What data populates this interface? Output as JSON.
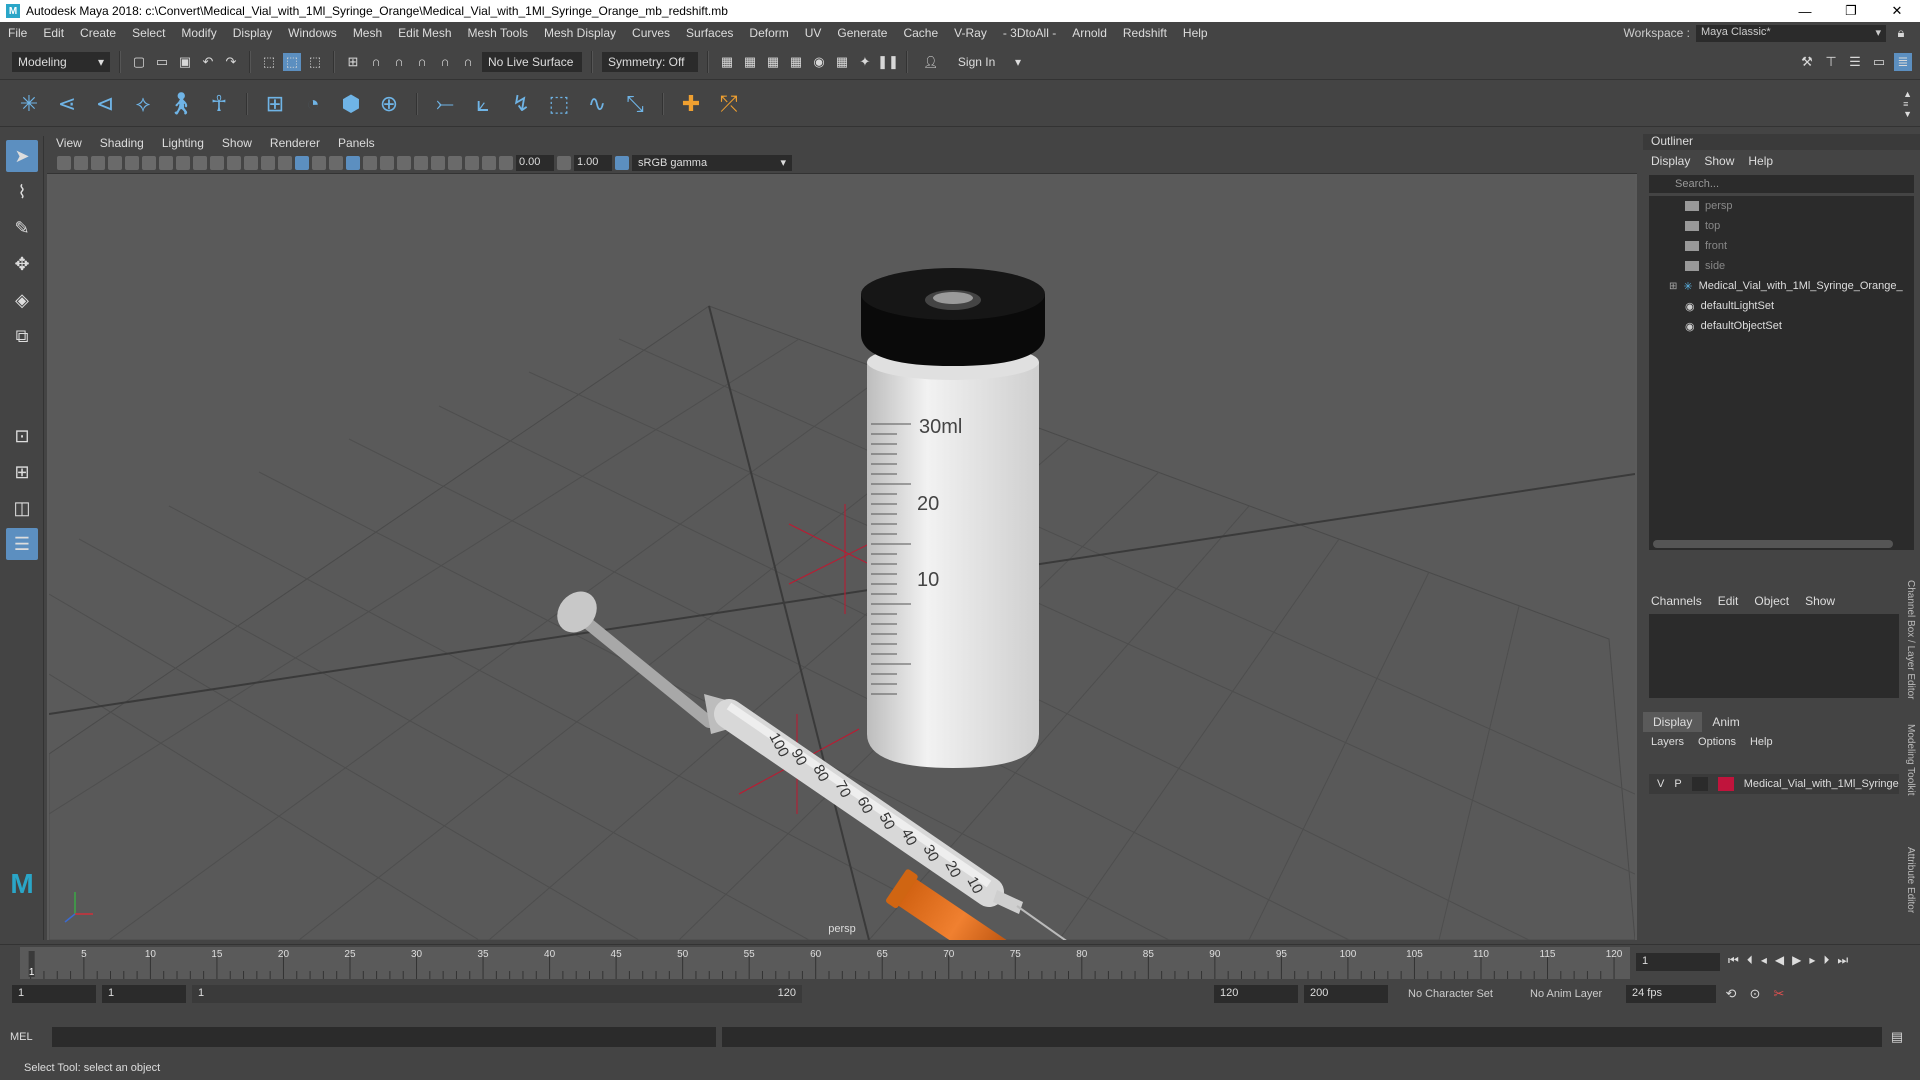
{
  "window": {
    "title": "Autodesk Maya 2018: c:\\Convert\\Medical_Vial_with_1Ml_Syringe_Orange\\Medical_Vial_with_1Ml_Syringe_Orange_mb_redshift.mb",
    "logo_letter": "M",
    "controls": {
      "minimize": "—",
      "maximize": "❐",
      "close": "✕"
    }
  },
  "menubar": {
    "items": [
      "File",
      "Edit",
      "Create",
      "Select",
      "Modify",
      "Display",
      "Windows",
      "Mesh",
      "Edit Mesh",
      "Mesh Tools",
      "Mesh Display",
      "Curves",
      "Surfaces",
      "Deform",
      "UV",
      "Generate",
      "Cache",
      "V-Ray",
      "- 3DtoAll -",
      "Arnold",
      "Redshift",
      "Help"
    ],
    "workspace_label": "Workspace :",
    "workspace_value": "Maya Classic*"
  },
  "statusline": {
    "mode": "Modeling",
    "live_surface": "No Live Surface",
    "symmetry": "Symmetry: Off",
    "sign_in": "Sign In"
  },
  "viewport": {
    "menu": [
      "View",
      "Shading",
      "Lighting",
      "Show",
      "Renderer",
      "Panels"
    ],
    "exposure": "0.00",
    "gamma": "1.00",
    "color_space": "sRGB gamma",
    "camera_label": "persp",
    "vial_labels": [
      "30ml",
      "20",
      "10"
    ],
    "syringe_labels": [
      "100",
      "90",
      "80",
      "70",
      "60",
      "50",
      "40",
      "30",
      "20",
      "10"
    ]
  },
  "outliner": {
    "title": "Outliner",
    "menu": [
      "Display",
      "Show",
      "Help"
    ],
    "search_placeholder": "Search...",
    "items": [
      {
        "label": "persp",
        "dim": true
      },
      {
        "label": "top",
        "dim": true
      },
      {
        "label": "front",
        "dim": true
      },
      {
        "label": "side",
        "dim": true
      },
      {
        "label": "Medical_Vial_with_1Ml_Syringe_Orange_",
        "dim": false
      },
      {
        "label": "defaultLightSet",
        "dim": false
      },
      {
        "label": "defaultObjectSet",
        "dim": false
      }
    ]
  },
  "channelbox": {
    "menu": [
      "Channels",
      "Edit",
      "Object",
      "Show"
    ]
  },
  "layereditor": {
    "tabs": [
      "Display",
      "Anim"
    ],
    "menu": [
      "Layers",
      "Options",
      "Help"
    ],
    "layer": {
      "v": "V",
      "p": "P",
      "name": "Medical_Vial_with_1Ml_Syringe",
      "color": "#c0143c"
    }
  },
  "sidetabs": [
    "Channel Box / Layer Editor",
    "Modeling Toolkit",
    "Attribute Editor"
  ],
  "timeline": {
    "ticks": [
      "5",
      "10",
      "15",
      "20",
      "25",
      "30",
      "35",
      "40",
      "45",
      "50",
      "55",
      "60",
      "65",
      "70",
      "75",
      "80",
      "85",
      "90",
      "95",
      "100",
      "105",
      "110",
      "115",
      "120"
    ],
    "current_frame_marker": "1",
    "current_frame": "1"
  },
  "range": {
    "start": "1",
    "start2": "1",
    "slider_start": "1",
    "slider_end": "120",
    "end": "120",
    "end2": "200",
    "character_set": "No Character Set",
    "anim_layer": "No Anim Layer",
    "fps": "24 fps"
  },
  "cmdline": {
    "label": "MEL"
  },
  "helpline": {
    "text": "Select Tool: select an object"
  },
  "colors": {
    "accent": "#5c8fc0",
    "bg": "#444444",
    "field": "#2b2b2b"
  }
}
